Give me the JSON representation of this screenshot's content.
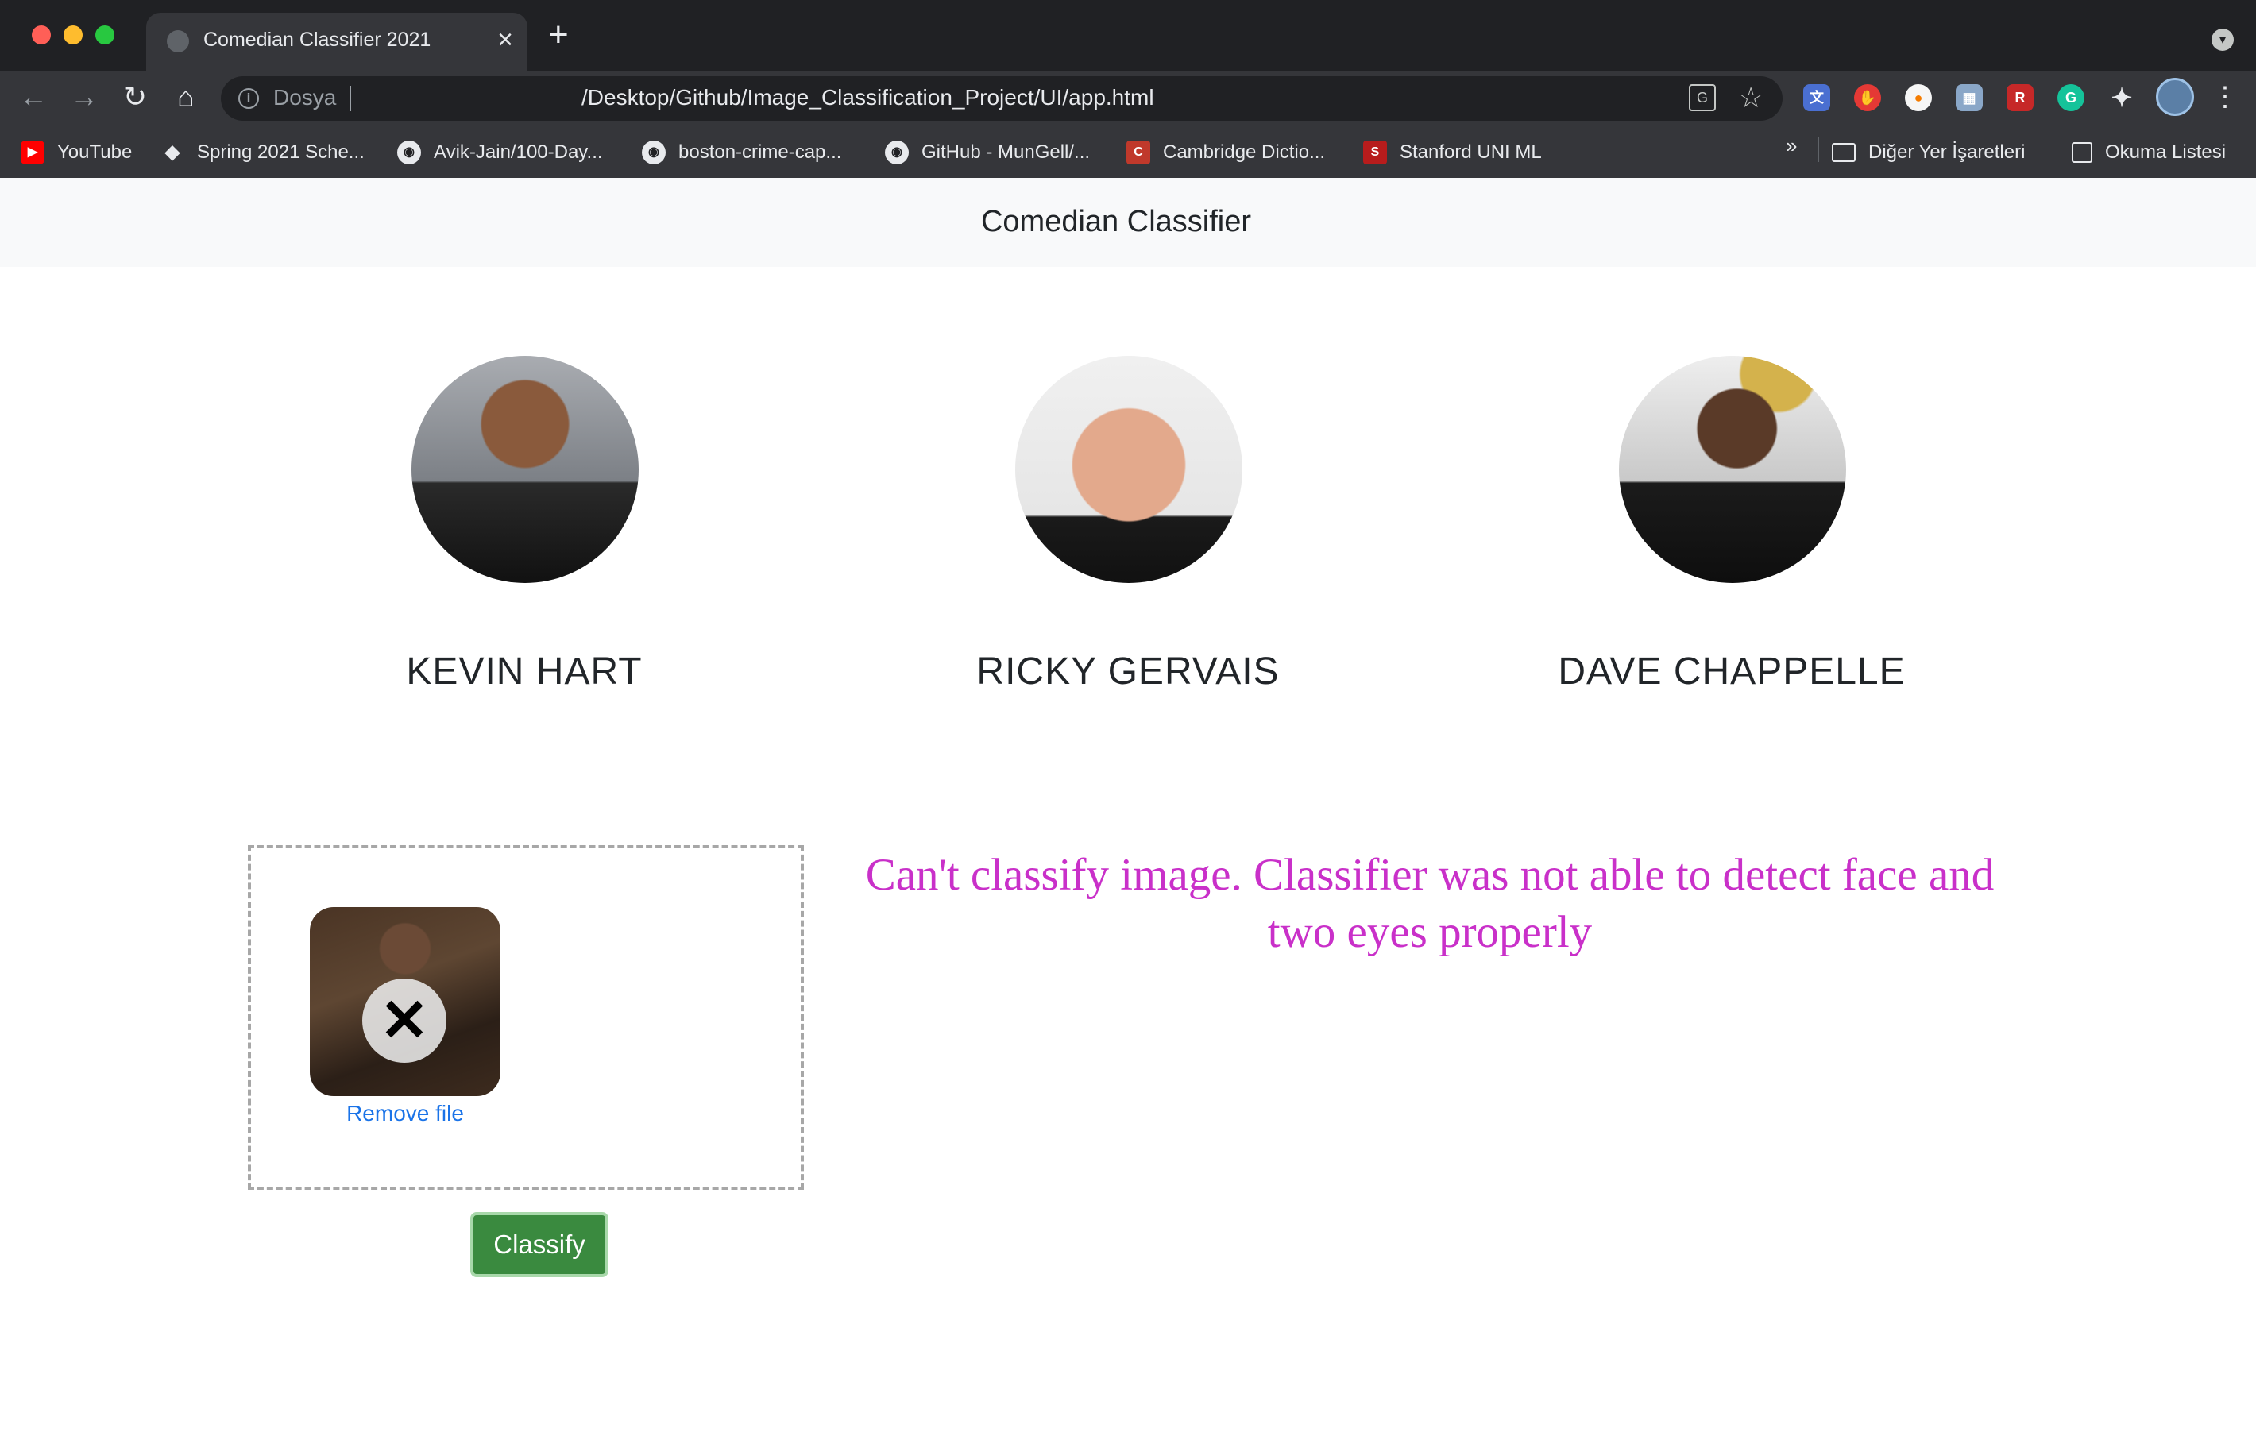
{
  "browser": {
    "tab": {
      "title": "Comedian Classifier 2021",
      "close": "×"
    },
    "new_tab": "+",
    "omnibox": {
      "scheme_label": "Dosya",
      "url": "/Desktop/Github/Image_Classification_Project/UI/app.html"
    },
    "bookmarks": [
      {
        "label": "YouTube",
        "icon": "youtube-icon"
      },
      {
        "label": "Spring 2021 Sche...",
        "icon": "spring-icon"
      },
      {
        "label": "Avik-Jain/100-Day...",
        "icon": "github-icon"
      },
      {
        "label": "boston-crime-cap...",
        "icon": "github-icon"
      },
      {
        "label": "GitHub - MunGell/...",
        "icon": "github-icon"
      },
      {
        "label": "Cambridge Dictio...",
        "icon": "cambridge-icon"
      },
      {
        "label": "Stanford UNI ML",
        "icon": "stanford-icon"
      }
    ],
    "bookmarks_more": "»",
    "other_bookmarks": "Diğer Yer İşaretleri",
    "reading_list": "Okuma Listesi"
  },
  "page": {
    "navbar_title": "Comedian Classifier",
    "comedians": [
      {
        "name": "KEVIN HART"
      },
      {
        "name": "RICKY GERVAIS"
      },
      {
        "name": "DAVE CHAPPELLE"
      }
    ],
    "dropzone": {
      "remove_label": "Remove file"
    },
    "classify_label": "Classify",
    "error_message": "Can't classify image. Classifier was not able to detect face and two eyes properly"
  },
  "colors": {
    "error_text": "#c930c9",
    "classify_button": "#3a8a3f",
    "link": "#1a73e8"
  }
}
